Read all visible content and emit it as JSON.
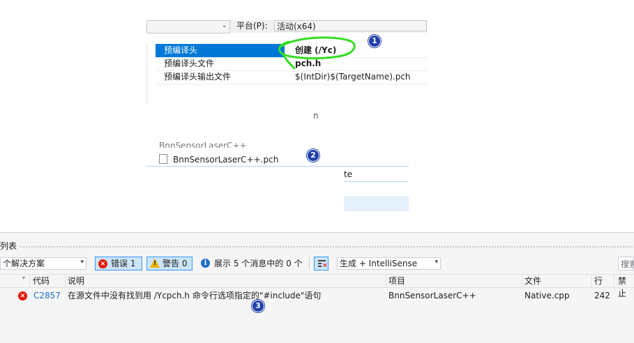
{
  "property_page": {
    "platform_label": "平台(P):",
    "platform_value": "活动(x64)",
    "rows": [
      {
        "name": "预编译头",
        "value": "创建 (/Yc)",
        "selected": true
      },
      {
        "name": "预编译头文件",
        "value": "pch.h",
        "selected": false
      },
      {
        "name": "预编译头输出文件",
        "value": "$(IntDir)$(TargetName).pch",
        "selected": false
      }
    ]
  },
  "background": {
    "stray_char": "n",
    "partial_file": "BnnSensorLaserC++",
    "pch_file": "BnnSensorLaserC++.pch",
    "te_text": "te"
  },
  "markers": [
    "1",
    "2",
    "3"
  ],
  "error_list": {
    "title": "列表",
    "scope_value": "个解决方案",
    "errors_label": "错误 1",
    "warnings_label": "警告 0",
    "messages_label": "展示 5 个消息中的 0 个",
    "build_filter": "生成 + IntelliSense",
    "search_placeholder": "搜索",
    "columns": {
      "code": "代码",
      "description": "说明",
      "project": "项目",
      "file": "文件",
      "line": "行",
      "suppress": "禁止"
    },
    "rows": [
      {
        "code": "C2857",
        "description": "在源文件中没有找到用 /Ycpch.h 命令行选项指定的\"#include\"语句",
        "project": "BnnSensorLaserC++",
        "file": "Native.cpp",
        "line": "242",
        "suppress": ""
      }
    ]
  },
  "colors": {
    "selection": "#0078d7",
    "marker": "#1f3fa8",
    "annotation_green": "#33dd22",
    "error_red": "#e51400"
  },
  "icons": [
    "chevron-down-icon",
    "file-icon",
    "error-icon",
    "warning-icon",
    "info-icon",
    "filter-icon"
  ]
}
